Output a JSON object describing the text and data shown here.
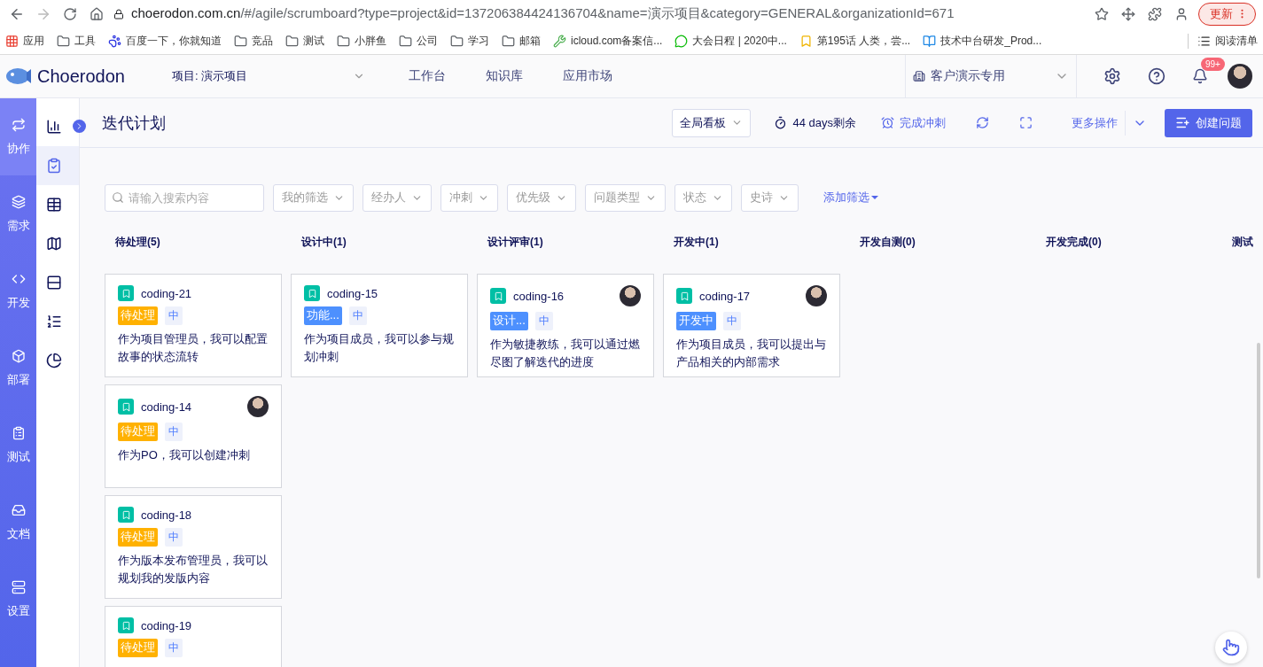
{
  "browser": {
    "url_host": "choerodon.com.cn",
    "url_path": "/#/agile/scrumboard?type=project&id=137206384424136704&name=演示项目&category=GENERAL&organizationId=671",
    "update_button": "更新",
    "bookmarks": [
      {
        "kind": "apps",
        "label": "应用"
      },
      {
        "kind": "folder",
        "label": "工具"
      },
      {
        "kind": "paw",
        "label": "百度一下，你就知道"
      },
      {
        "kind": "folder",
        "label": "竞品"
      },
      {
        "kind": "folder",
        "label": "测试"
      },
      {
        "kind": "folder",
        "label": "小胖鱼"
      },
      {
        "kind": "folder",
        "label": "公司"
      },
      {
        "kind": "folder",
        "label": "学习"
      },
      {
        "kind": "folder",
        "label": "邮箱"
      },
      {
        "kind": "tool",
        "label": "icloud.com备案信..."
      },
      {
        "kind": "chat",
        "label": "大会日程 | 2020中..."
      },
      {
        "kind": "comic",
        "label": "第195话 人类，尝..."
      },
      {
        "kind": "w",
        "label": "技术中台研发_Prod..."
      }
    ],
    "reading_list": "阅读清单"
  },
  "header": {
    "logo": "Choerodon",
    "project": "项目: 演示项目",
    "nav": [
      "工作台",
      "知识库",
      "应用市场"
    ],
    "organization": "客户演示专用",
    "notifications": "99+"
  },
  "rail": [
    {
      "label": "协作",
      "selected": true
    },
    {
      "label": "需求",
      "selected": false
    },
    {
      "label": "开发",
      "selected": false
    },
    {
      "label": "部署",
      "selected": false
    },
    {
      "label": "测试",
      "selected": false
    },
    {
      "label": "文档",
      "selected": false
    },
    {
      "label": "设置",
      "selected": false
    }
  ],
  "subnav": [
    {
      "kind": "chart",
      "selected": false
    },
    {
      "kind": "check",
      "selected": true
    },
    {
      "kind": "table",
      "selected": false
    },
    {
      "kind": "map",
      "selected": false
    },
    {
      "kind": "rows",
      "selected": false
    },
    {
      "kind": "list",
      "selected": false
    },
    {
      "kind": "pie",
      "selected": false
    }
  ],
  "page": {
    "title": "迭代计划",
    "board_select": "全局看板",
    "remaining": "44 days剩余",
    "complete_sprint": "完成冲刺",
    "more_actions": "更多操作",
    "create_issue": "创建问题"
  },
  "filters": {
    "search_placeholder": "请输入搜索内容",
    "dropdowns": [
      "我的筛选",
      "经办人",
      "冲刺",
      "优先级",
      "问题类型",
      "状态",
      "史诗"
    ],
    "add_filter": "添加筛选"
  },
  "columns": [
    {
      "title": "待处理(5)",
      "cards": [
        {
          "key": "coding-21",
          "status": "待处理",
          "color": "#ffb100",
          "priority": "中",
          "summary": "作为项目管理员，我可以配置故事的状态流转",
          "assignee": false
        },
        {
          "key": "coding-14",
          "status": "待处理",
          "color": "#ffb100",
          "priority": "中",
          "summary": "作为PO，我可以创建冲刺",
          "assignee": true
        },
        {
          "key": "coding-18",
          "status": "待处理",
          "color": "#ffb100",
          "priority": "中",
          "summary": "作为版本发布管理员，我可以规划我的发版内容",
          "assignee": false
        },
        {
          "key": "coding-19",
          "status": "待处理",
          "color": "#ffb100",
          "priority": "中",
          "assignee": false
        }
      ]
    },
    {
      "title": "设计中(1)",
      "cards": [
        {
          "key": "coding-15",
          "status": "功能...",
          "color": "#4d90fe",
          "priority": "中",
          "summary": "作为项目成员，我可以参与规划冲刺",
          "assignee": false
        }
      ]
    },
    {
      "title": "设计评审(1)",
      "cards": [
        {
          "key": "coding-16",
          "status": "设计...",
          "color": "#4d90fe",
          "priority": "中",
          "summary": "作为敏捷教练，我可以通过燃尽图了解迭代的进度",
          "assignee": true
        }
      ]
    },
    {
      "title": "开发中(1)",
      "cards": [
        {
          "key": "coding-17",
          "status": "开发中",
          "color": "#4d90fe",
          "priority": "中",
          "summary": "作为项目成员，我可以提出与产品相关的内部需求",
          "assignee": true
        }
      ]
    },
    {
      "title": "开发自测(0)"
    },
    {
      "title": "开发完成(0)"
    },
    {
      "title": "测试"
    }
  ]
}
